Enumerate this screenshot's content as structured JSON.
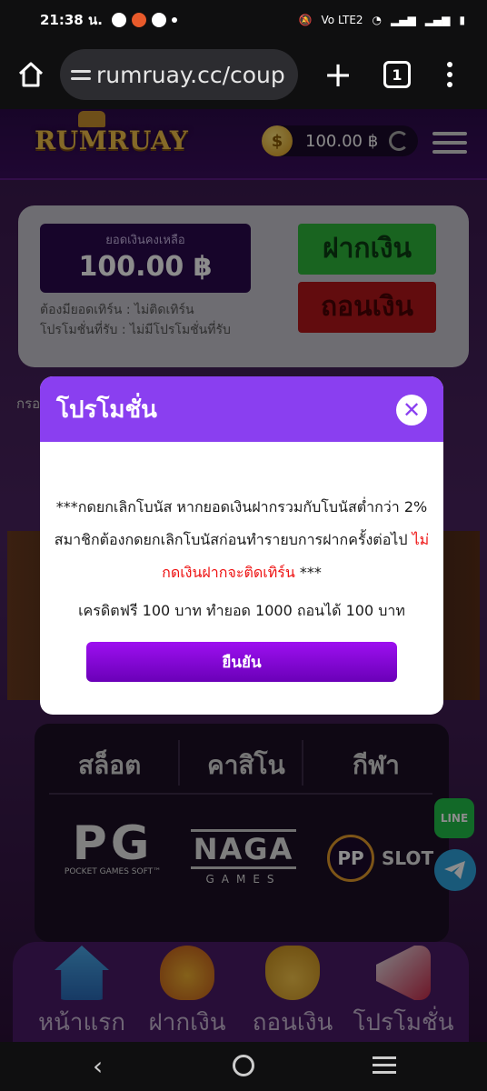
{
  "status_bar": {
    "time": "21:38 น.",
    "network": "Vo LTE2",
    "signal_1": "signal",
    "signal_2": "signal",
    "battery": "battery"
  },
  "browser": {
    "url": "rumruay.cc/coup",
    "tab_count": "1"
  },
  "header": {
    "logo": "RUMRUAY",
    "balance": "100.00 ฿"
  },
  "wallet": {
    "balance_label": "ยอดเงินคงเหลือ",
    "balance_value": "100.00 ฿",
    "turnover_note": "ต้องมียอดเทิร์น : ไม่ติดเทิร์น",
    "promo_note": "โปรโมชั่นที่รับ : ไม่มีโปรโมชั่นที่รับ",
    "deposit_label": "ฝากเงิน",
    "withdraw_label": "ถอนเงิน"
  },
  "behind_text": "กรอ",
  "games": {
    "tabs": [
      "สล็อต",
      "คาสิโน",
      "กีฬา"
    ],
    "providers": {
      "pg_big": "PG",
      "pg_small": "POCKET GAMES SOFT™",
      "naga_big": "NAGA",
      "naga_small": "GAMES",
      "pp_circle": "PP",
      "pp_text": "SLOT"
    }
  },
  "social": {
    "line_label": "LINE"
  },
  "bottom_nav": {
    "items": [
      "หน้าแรก",
      "ฝากเงิน",
      "ถอนเงิน",
      "โปรโมชั่น"
    ]
  },
  "modal": {
    "title": "โปรโมชั่น",
    "body_part1": "***กดยกเลิกโบนัส หากยอดเงินฝากรวมกับโบนัสต่ำกว่า 2% สมาชิกต้องกดยกเลิกโบนัสก่อนทำรายบการฝากครั้งต่อไป ",
    "body_red": "ไม่กดเงินฝากจะติดเทิร์น",
    "body_part2": " ***",
    "body_line2": "เครดิตฟรี 100 บาท ทำยอด 1000 ถอนได้ 100 บาท",
    "confirm_label": "ยืนยัน"
  },
  "colors": {
    "modal_header": "#8a3ff0",
    "deposit_button": "#2fb63b",
    "withdraw_button": "#b3161b",
    "confirm_button": "#8a0ddc"
  }
}
